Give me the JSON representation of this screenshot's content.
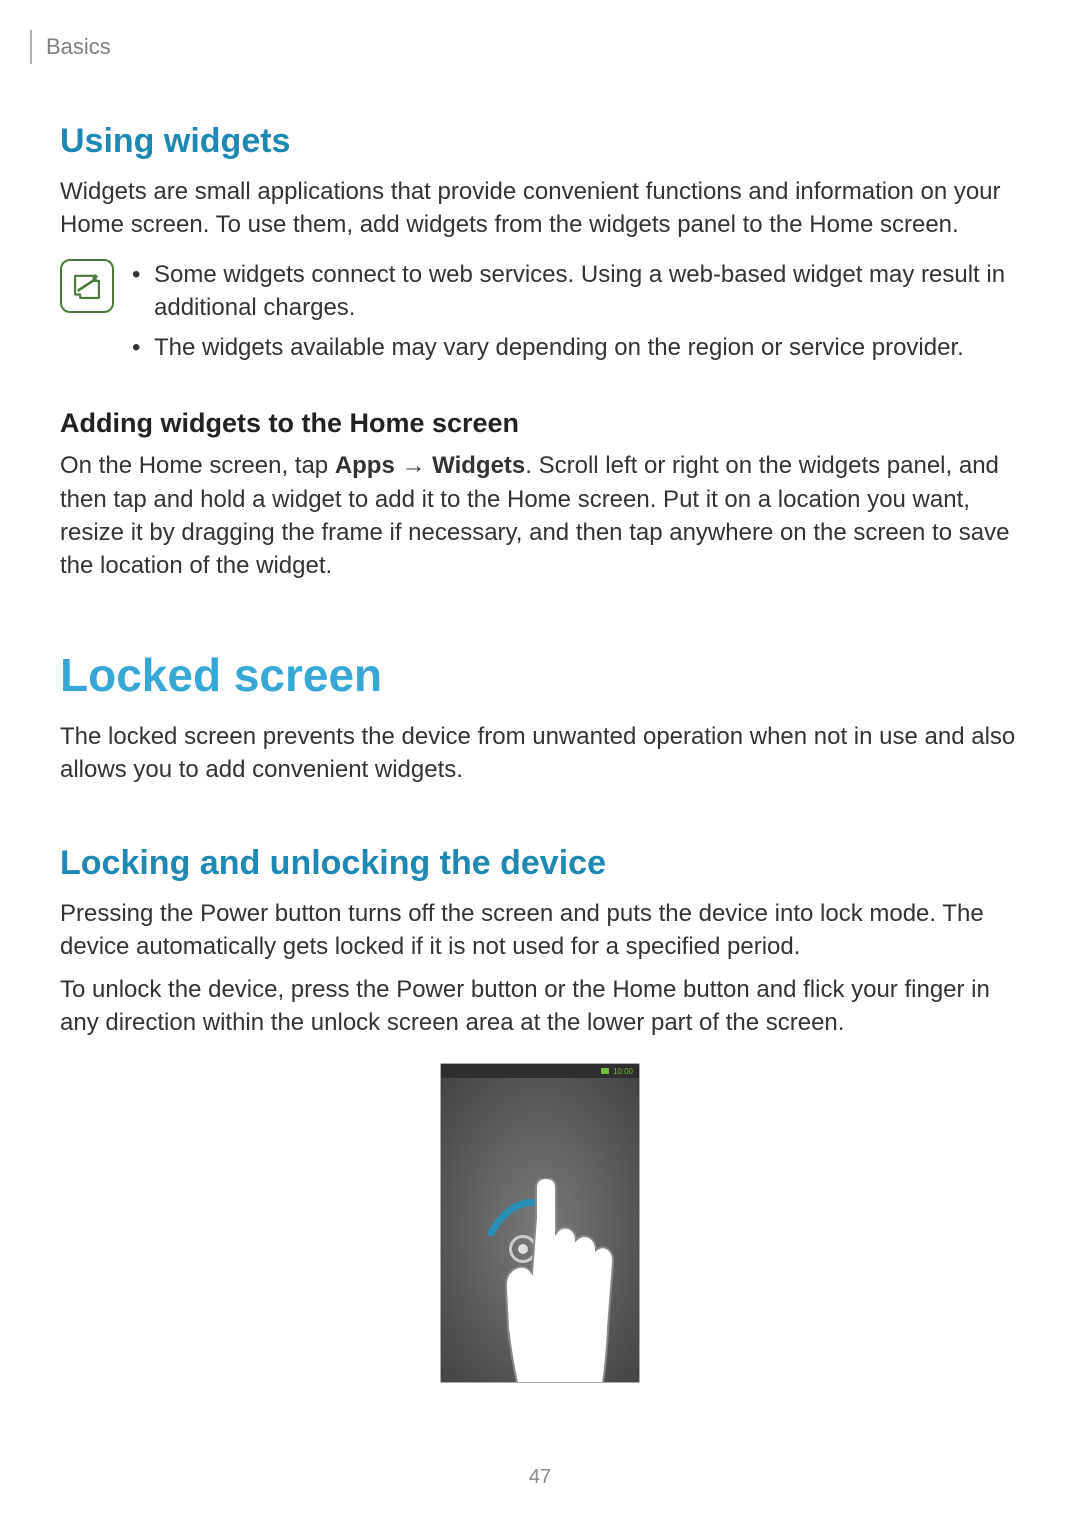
{
  "header": {
    "breadcrumb": "Basics"
  },
  "sections": {
    "using_widgets": {
      "title": "Using widgets",
      "intro": "Widgets are small applications that provide convenient functions and information on your Home screen. To use them, add widgets from the widgets panel to the Home screen.",
      "notes": [
        "Some widgets connect to web services. Using a web-based widget may result in additional charges.",
        "The widgets available may vary depending on the region or service provider."
      ],
      "adding": {
        "heading": "Adding widgets to the Home screen",
        "pre": "On the Home screen, tap ",
        "apps": "Apps",
        "arrow": " → ",
        "widgets": "Widgets",
        "post": ". Scroll left or right on the widgets panel, and then tap and hold a widget to add it to the Home screen. Put it on a location you want, resize it by dragging the frame if necessary, and then tap anywhere on the screen to save the location of the widget."
      }
    },
    "locked_screen": {
      "title": "Locked screen",
      "intro": "The locked screen prevents the device from unwanted operation when not in use and also allows you to add convenient widgets."
    },
    "locking": {
      "title": "Locking and unlocking the device",
      "p1": "Pressing the Power button turns off the screen and puts the device into lock mode. The device automatically gets locked if it is not used for a specified period.",
      "p2": "To unlock the device, press the Power button or the Home button and flick your finger in any direction within the unlock screen area at the lower part of the screen."
    }
  },
  "phone": {
    "clock": "10:00"
  },
  "page_number": "47"
}
